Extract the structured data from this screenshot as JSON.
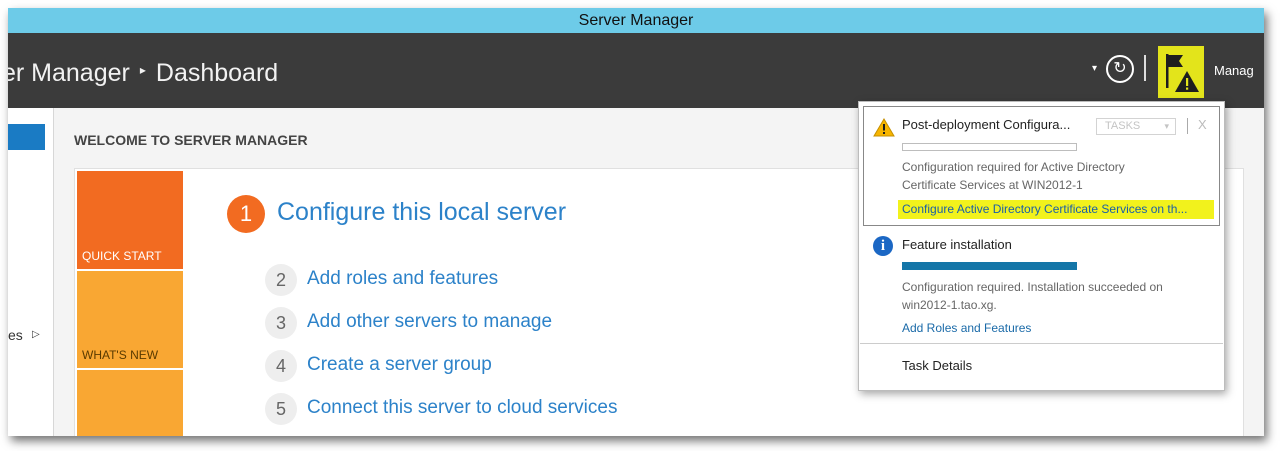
{
  "window": {
    "title": "Server Manager"
  },
  "header": {
    "breadcrumb_app": "er Manager",
    "breadcrumb_sep": "▸",
    "breadcrumb_page": "Dashboard",
    "dropdown_glyph": "▾",
    "refresh_glyph": "↻",
    "manage_label": "Manag"
  },
  "sidebar": {
    "partial_item": "es",
    "caret": "▷"
  },
  "main": {
    "welcome_title": "WELCOME TO SERVER MANAGER",
    "tiles": {
      "quick_start": "QUICK START",
      "whats_new": "WHAT'S NEW"
    },
    "step1": {
      "number": "1",
      "label": "Configure this local server"
    },
    "steps": [
      {
        "number": "2",
        "label": "Add roles and features"
      },
      {
        "number": "3",
        "label": "Add other servers to manage"
      },
      {
        "number": "4",
        "label": "Create a server group"
      },
      {
        "number": "5",
        "label": "Connect this server to cloud services"
      }
    ]
  },
  "notifications": {
    "item1": {
      "icon": "warning-icon",
      "title": "Post-deployment Configura...",
      "tasks_label": "TASKS",
      "tasks_arrow": "▾",
      "close_label": "X",
      "desc_line1": "Configuration required for Active Directory",
      "desc_line2": "Certificate Services at WIN2012-1",
      "link": "Configure Active Directory Certificate Services on th..."
    },
    "item2": {
      "icon": "info-icon",
      "icon_glyph": "i",
      "title": "Feature installation",
      "progress": 1.0,
      "desc_line1": "Configuration required. Installation succeeded on",
      "desc_line2": "win2012-1.tao.xg.",
      "link": "Add Roles and Features"
    },
    "task_details": "Task Details"
  },
  "colors": {
    "titlebar": "#6dcbe8",
    "header": "#3b3b3b",
    "flag_highlight": "#e3e41b",
    "accent_orange": "#f26b21",
    "tile_amber": "#f9a733",
    "link_blue": "#2c82c9",
    "progress_teal": "#1476a8"
  }
}
